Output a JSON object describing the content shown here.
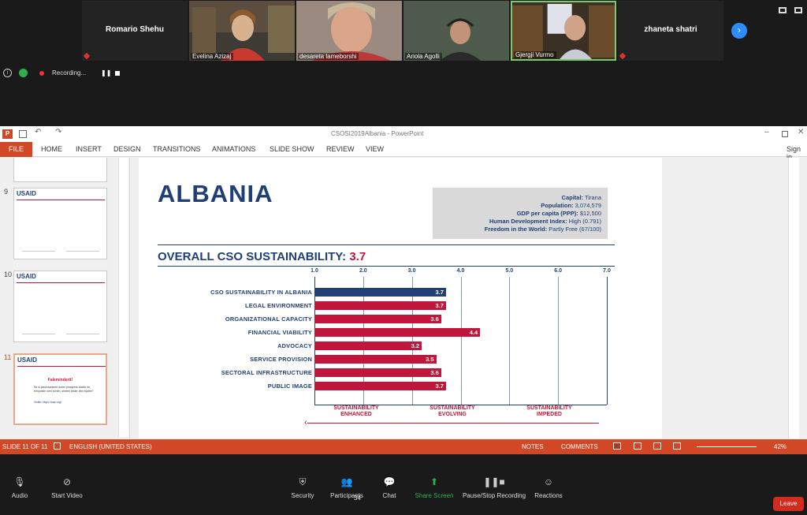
{
  "meeting": {
    "participants": [
      {
        "name": "Romario Shehu",
        "video": false
      },
      {
        "name": "Evelina Azizaj",
        "video": true
      },
      {
        "name": "desareta lameborshi",
        "video": true
      },
      {
        "name": "Ariola Agolli",
        "video": true
      },
      {
        "name": "Gjergji Vurmo",
        "video": true
      },
      {
        "name": "zhaneta shatri",
        "video": false
      }
    ],
    "recording_label": "Recording..."
  },
  "ppt": {
    "title": "CSOSI2019Albania - PowerPoint",
    "file_tab": "FILE",
    "tabs": [
      "HOME",
      "INSERT",
      "DESIGN",
      "TRANSITIONS",
      "ANIMATIONS",
      "SLIDE SHOW",
      "REVIEW",
      "VIEW"
    ],
    "sign_in": "Sign in",
    "thumb_numbers": [
      "9",
      "10",
      "11"
    ],
    "thumb11": {
      "title": "Faleminderit!",
      "body": "Se si perdoruesime dorhe phaqeme arcide ne, frimposen shm kohen, sheten tinder dhe mjaltin?",
      "link": "Visitto: https://cssi.org/"
    },
    "status": {
      "slide": "SLIDE 11 OF 11",
      "lang": "ENGLISH (UNITED STATES)",
      "notes": "NOTES",
      "comments": "COMMENTS",
      "zoom": "42%"
    }
  },
  "slide": {
    "country": "ALBANIA",
    "info": [
      {
        "k": "Capital:",
        "v": "Tirana"
      },
      {
        "k": "Population:",
        "v": "3,074,579"
      },
      {
        "k": "GDP per capita (PPP):",
        "v": "$12,500"
      },
      {
        "k": "Human Development Index:",
        "v": "High (0.791)"
      },
      {
        "k": "Freedom in the World:",
        "v": "Partly Free (67/100)"
      }
    ],
    "overall_label": "OVERALL CSO SUSTAINABILITY:",
    "overall_value": "3.7",
    "zones": [
      "SUSTAINABILITY ENHANCED",
      "SUSTAINABILITY EVOLVING",
      "SUSTAINABILITY IMPEDED"
    ]
  },
  "chart_data": {
    "type": "bar",
    "orientation": "horizontal",
    "categories": [
      "CSO SUSTAINABILITY IN ALBANIA",
      "LEGAL ENVIRONMENT",
      "ORGANIZATIONAL CAPACITY",
      "FINANCIAL VIABILITY",
      "ADVOCACY",
      "SERVICE PROVISION",
      "SECTORAL INFRASTRUCTURE",
      "PUBLIC IMAGE"
    ],
    "values": [
      3.7,
      3.7,
      3.6,
      4.4,
      3.2,
      3.5,
      3.6,
      3.7
    ],
    "xlim": [
      1.0,
      7.0
    ],
    "ticks": [
      "1.0",
      "2.0",
      "3.0",
      "4.0",
      "5.0",
      "6.0",
      "7.0"
    ],
    "colors": {
      "overall": "#1f3f76",
      "dimension": "#c0163c"
    }
  },
  "controls": {
    "buttons": [
      "Audio",
      "Start Video",
      "Security",
      "Participants",
      "Chat",
      "Share Screen",
      "Pause/Stop Recording",
      "Reactions"
    ],
    "participant_count": "34",
    "leave": "Leave"
  }
}
